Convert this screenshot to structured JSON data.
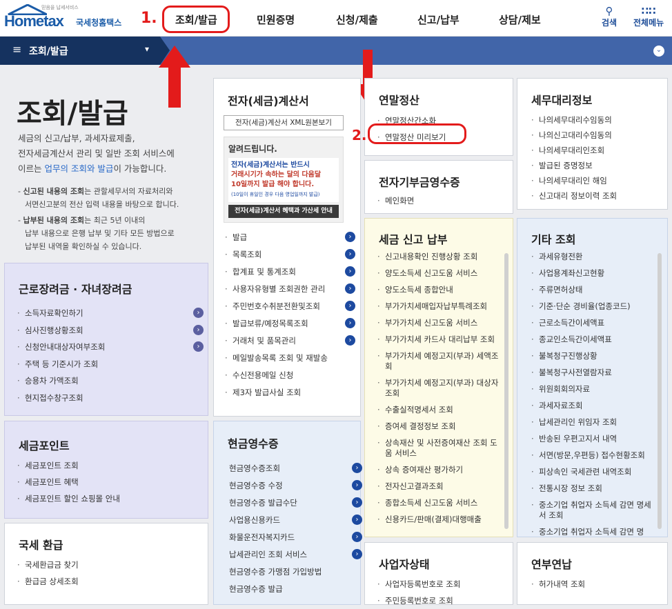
{
  "header": {
    "logo_small": "믿음을 납세서비스",
    "logo_main": "Hometax",
    "logo_sub": "국세청홈택스",
    "nav": [
      "조회/발급",
      "민원증명",
      "신청/제출",
      "신고/납부",
      "상담/제보"
    ],
    "search": "검색",
    "allmenu": "전체메뉴"
  },
  "annotations": {
    "step1": "1.",
    "step2": "2."
  },
  "bar": {
    "title": "조회/발급",
    "menu_icon": "≡",
    "dropdown_icon": "▾",
    "chevron_icon": "⌄"
  },
  "intro": {
    "title": "조회/발급",
    "desc_lines": [
      "세금의 신고/납부, 과세자료제출,",
      "전자세금계산서 관리 및 일반 조회 서비스에"
    ],
    "desc3_pre": "이르는 ",
    "desc3_hl": "업무의 조회와 발급",
    "desc3_post": "이 가능합니다.",
    "note1_bold": "신고된 내용의 조회",
    "note1_rest": "는 관할세무서의 자료처리와",
    "note1_line2": "서면신고분의 전산 입력 내용을 바탕으로 합니다.",
    "note2_bold": "납부된 내용의 조회",
    "note2_rest": "는 최근 5년 이내의",
    "note2_line2": "납부 내용으로 은행 납부 및 기타 모든 방법으로",
    "note2_line3": "납부된 내역을 확인하실 수 있습니다."
  },
  "panels": {
    "etax": {
      "title": "전자(세금)계산서",
      "button": "전자(세금)계산서 XML원본보기",
      "notice_title": "알려드립니다.",
      "notice_l1": "전자(세금)계산서는 반드시",
      "notice_l2": "거래시기가 속하는 달의 다음달",
      "notice_l3": "10일까지 발급 해야 합니다.",
      "notice_l4": "(10일이 휴일인 경우 다음 영업일까지 발급)",
      "notice_btn": "전자(세금)계산서 혜택과 가산세 안내",
      "items": [
        "발급",
        "목록조회",
        "합계표 및 통계조회",
        "사용자유형별 조회권한 관리",
        "주민번호수취분전환및조회",
        "발급보류/예정목록조회",
        "거래처 및 품목관리",
        "메일발송목록 조회 및 재발송",
        "수신전용메일 신청",
        "제3자 발급사실 조회"
      ]
    },
    "yearend": {
      "title": "연말정산",
      "items": [
        "연말정산간소화",
        "연말정산 미리보기"
      ]
    },
    "agent": {
      "title": "세무대리정보",
      "items": [
        "나의세무대리수임동의",
        "나의신고대리수임동의",
        "나의세무대리인조회",
        "발급된 증명정보",
        "나의세무대리인 해임",
        "신고대리 정보이력 조회"
      ]
    },
    "donation": {
      "title": "전자기부금영수증",
      "items": [
        "메인화면"
      ]
    },
    "earned": {
      "title": "근로장려금 · 자녀장려금",
      "items": [
        "소득자료확인하기",
        "심사진행상황조회",
        "신청안내대상자여부조회",
        "주택 등 기준시가 조회",
        "승용차 가액조회",
        "현지접수창구조회"
      ]
    },
    "taxreport": {
      "title": "세금 신고 납부",
      "items": [
        "신고내용확인 진행상황 조회",
        "양도소득세 신고도움 서비스",
        "양도소득세 종합안내",
        "부가가치세매입자납부특례조회",
        "부가가치세 신고도움 서비스",
        "부가가치세 카드사 대리납부 조회",
        "부가가치세 예정고지(부과) 세액조회",
        "부가가치세 예정고지(부과) 대상자 조회",
        "수출실적명세서 조회",
        "증여세 결정정보 조회",
        "상속재산 및 사전증여재산 조회 도움 서비스",
        "상속 증여재산 평가하기",
        "전자신고결과조회",
        "종합소득세 신고도움 서비스",
        "신용카드/판매(결제)대행매출"
      ]
    },
    "other": {
      "title": "기타 조회",
      "items": [
        "과세유형전환",
        "사업용계좌신고현황",
        "주류면허상태",
        "기준·단순 경비율(업종코드)",
        "근로소득간이세액표",
        "종교인소득간이세액표",
        "불복청구진행상황",
        "불복청구사전열람자료",
        "위원회회의자료",
        "과세자료조회",
        "납세관리인 위임자 조회",
        "반송된 우편고지서 내역",
        "서면(방문,우편등) 접수현황조회",
        "피상속인 국세관련 내역조회",
        "전통시장 정보 조회",
        "중소기업 취업자 소득세 감면 명세서 조회",
        "중소기업 취업자 소득세 감면 명"
      ]
    },
    "point": {
      "title": "세금포인트",
      "items": [
        "세금포인트 조회",
        "세금포인트 혜택",
        "세금포인트 할인 쇼핑몰 안내"
      ]
    },
    "cash": {
      "title": "현금영수증",
      "items": [
        "현금영수증조회",
        "현금영수증 수정",
        "현금영수증 발급수단",
        "사업용신용카드",
        "화물운전자복지카드",
        "납세관리인 조회 서비스",
        "현금영수증 가맹점 가입방법",
        "현금영수증 발급"
      ]
    },
    "refund": {
      "title": "국세 환급",
      "items": [
        "국세환급금 찾기",
        "환급금 상세조회"
      ]
    },
    "business": {
      "title": "사업자상태",
      "items": [
        "사업자등록번호로 조회",
        "주민등록번호로 조회"
      ]
    },
    "pension": {
      "title": "연부연납",
      "items": [
        "허가내역 조회"
      ]
    }
  },
  "colors": {
    "accent": "#1d4aa0",
    "bar": "#4165a9",
    "bar_dark": "#15325f",
    "annotation": "#e31b1b"
  }
}
